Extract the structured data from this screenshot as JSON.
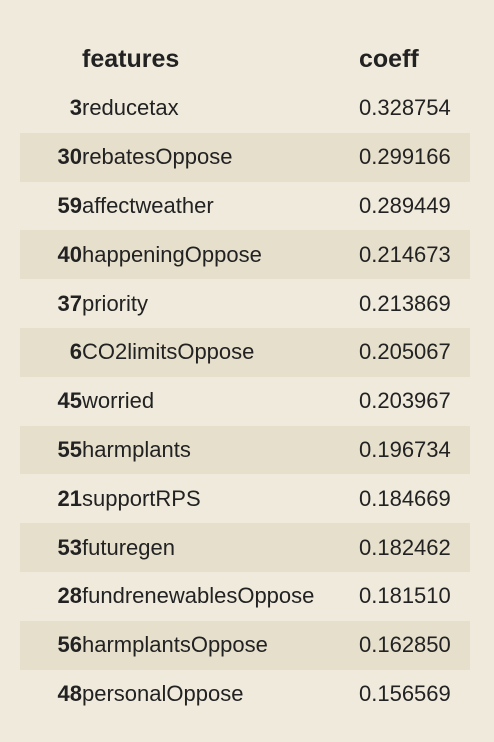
{
  "table": {
    "columns": [
      "",
      "features",
      "coeff"
    ],
    "rows": [
      {
        "index": "3",
        "feature": "reducetax",
        "coeff": "0.328754"
      },
      {
        "index": "30",
        "feature": "rebatesOppose",
        "coeff": "0.299166"
      },
      {
        "index": "59",
        "feature": "affectweather",
        "coeff": "0.289449"
      },
      {
        "index": "40",
        "feature": "happeningOppose",
        "coeff": "0.214673"
      },
      {
        "index": "37",
        "feature": "priority",
        "coeff": "0.213869"
      },
      {
        "index": "6",
        "feature": "CO2limitsOppose",
        "coeff": "0.205067"
      },
      {
        "index": "45",
        "feature": "worried",
        "coeff": "0.203967"
      },
      {
        "index": "55",
        "feature": "harmplants",
        "coeff": "0.196734"
      },
      {
        "index": "21",
        "feature": "supportRPS",
        "coeff": "0.184669"
      },
      {
        "index": "53",
        "feature": "futuregen",
        "coeff": "0.182462"
      },
      {
        "index": "28",
        "feature": "fundrenewablesOppose",
        "coeff": "0.181510"
      },
      {
        "index": "56",
        "feature": "harmplantsOppose",
        "coeff": "0.162850"
      },
      {
        "index": "48",
        "feature": "personalOppose",
        "coeff": "0.156569"
      }
    ]
  },
  "colors": {
    "background": "#efeadc",
    "striped_row": "#e5dfcc",
    "text": "#222222"
  }
}
